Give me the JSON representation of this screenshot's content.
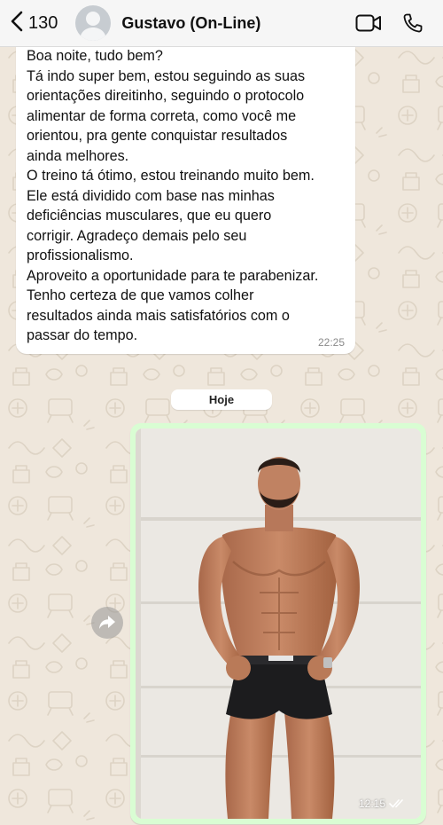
{
  "header": {
    "back_count": "130",
    "contact_name": "Gustavo (On-Line)"
  },
  "messages": [
    {
      "direction": "incoming",
      "lines": [
        "Boa noite, tudo bem?",
        "Tá indo super bem, estou seguindo as suas",
        "orientações direitinho, seguindo o protocolo",
        "alimentar de forma correta, como você me",
        "orientou, pra gente conquistar resultados",
        "ainda melhores.",
        "O treino tá ótimo, estou treinando muito bem.",
        "Ele está dividido com base nas minhas",
        "deficiências musculares, que eu quero",
        "corrigir. Agradeço demais pelo seu",
        "profissionalismo.",
        "Aproveito a oportunidade para te parabenizar.",
        "Tenho certeza de que vamos colher",
        "resultados ainda mais satisfatórios com o",
        "passar do tempo."
      ],
      "time": "22:25"
    },
    {
      "direction": "outgoing",
      "type": "photo",
      "time": "12:15",
      "status_icon": "double-check-icon"
    }
  ],
  "day_separator": "Hoje",
  "icons": {
    "back": "chevron-left-icon",
    "avatar": "default-avatar-icon",
    "video": "video-camera-icon",
    "call": "phone-icon",
    "forward": "forward-arrow-icon"
  },
  "colors": {
    "chat_background": "#efe7dc",
    "incoming_bubble": "#ffffff",
    "outgoing_bubble": "#d9fdd3",
    "header_background": "#f6f6f6"
  }
}
